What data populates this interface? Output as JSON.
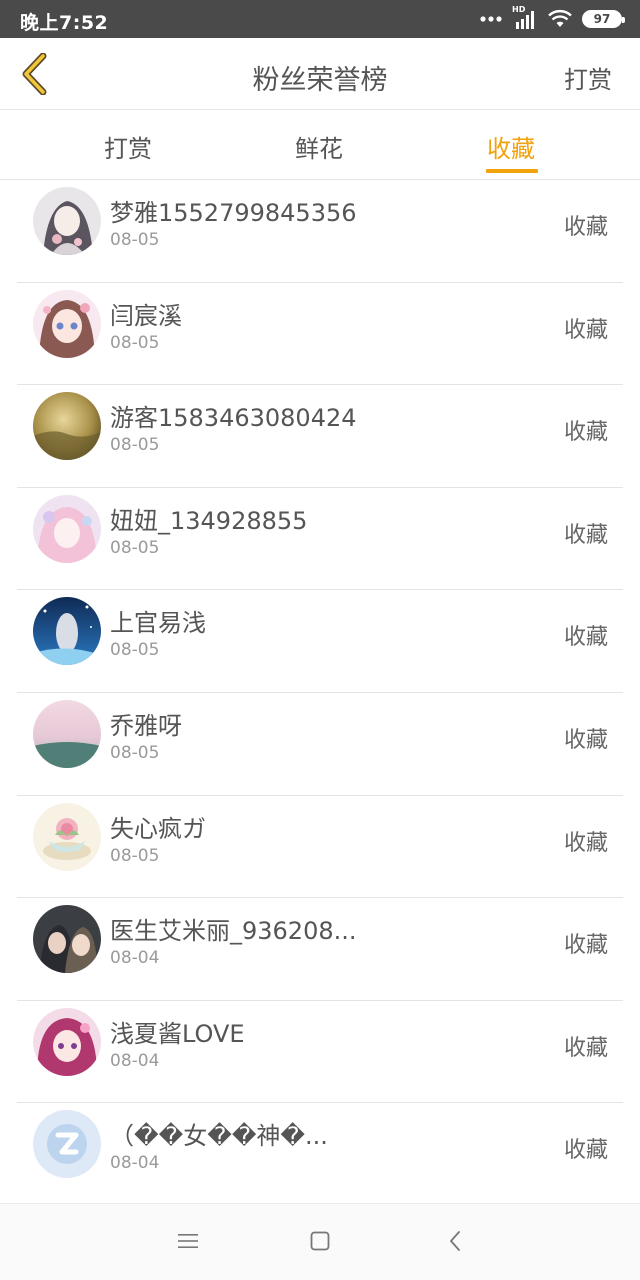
{
  "status_bar": {
    "time": "晚上7:52",
    "battery": "97",
    "network_label": "HD"
  },
  "header": {
    "back_icon": "chevron-left-icon",
    "title": "粉丝荣誉榜",
    "action": "打赏"
  },
  "tabs": [
    {
      "label": "打赏",
      "active": false
    },
    {
      "label": "鲜花",
      "active": false
    },
    {
      "label": "收藏",
      "active": true
    }
  ],
  "accent_color": "#f2a20a",
  "fans": [
    {
      "name": "梦雅1552799845356",
      "date": "08-05",
      "action": "收藏"
    },
    {
      "name": "闫宸溪",
      "date": "08-05",
      "action": "收藏"
    },
    {
      "name": "游客1583463080424",
      "date": "08-05",
      "action": "收藏"
    },
    {
      "name": "妞妞_134928855",
      "date": "08-05",
      "action": "收藏"
    },
    {
      "name": "上官易浅",
      "date": "08-05",
      "action": "收藏"
    },
    {
      "name": "乔雅呀",
      "date": "08-05",
      "action": "收藏"
    },
    {
      "name": "失心疯ガ",
      "date": "08-05",
      "action": "收藏"
    },
    {
      "name": "医生艾米丽_936208...",
      "date": "08-04",
      "action": "收藏"
    },
    {
      "name": "浅夏酱LOVE",
      "date": "08-04",
      "action": "收藏"
    },
    {
      "name": "（��女��神�...",
      "date": "08-04",
      "action": "收藏"
    }
  ],
  "system_nav": {
    "menu_icon": "menu-icon",
    "home_icon": "home-square-icon",
    "back_icon": "back-triangle-icon"
  }
}
